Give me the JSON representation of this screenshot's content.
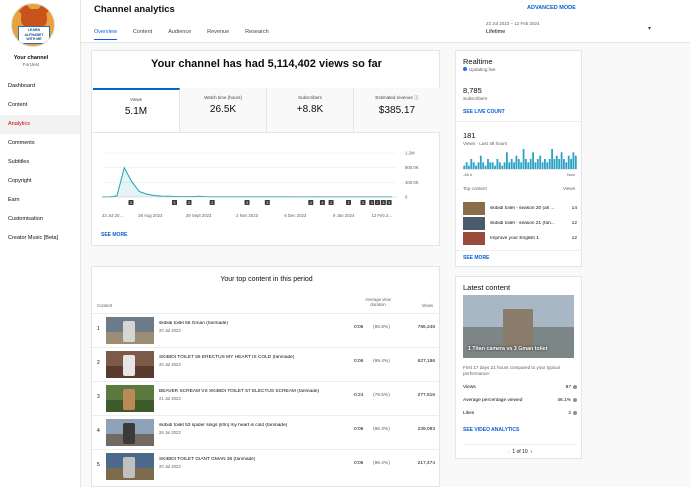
{
  "channel": {
    "name": "Your channel",
    "handle": "FortJest",
    "avatar_text": [
      "LEARN",
      "ALPHABET",
      "WITH ME"
    ]
  },
  "sidebar": {
    "items": [
      {
        "label": "Dashboard"
      },
      {
        "label": "Content"
      },
      {
        "label": "Analytics",
        "active": true
      },
      {
        "label": "Comments"
      },
      {
        "label": "Subtitles"
      },
      {
        "label": "Copyright"
      },
      {
        "label": "Earn"
      },
      {
        "label": "Customisation"
      },
      {
        "label": "Creator Music [Beta]"
      }
    ]
  },
  "header": {
    "title": "Channel analytics",
    "advanced_mode": "ADVANCED MODE",
    "tabs": [
      "Overview",
      "Content",
      "Audience",
      "Revenue",
      "Research"
    ],
    "date_range": "23 Jul 2023 – 12 Feb 2024",
    "date_value": "Lifetime"
  },
  "overview": {
    "headline": "Your channel has had 5,114,402 views so far",
    "metrics": [
      {
        "label": "Views",
        "value": "5.1M"
      },
      {
        "label": "Watch time (hours)",
        "value": "26.5K"
      },
      {
        "label": "Subscribers",
        "value": "+8.8K"
      },
      {
        "label": "Estimated revenue",
        "value": "$385.17"
      }
    ],
    "see_more": "SEE MORE"
  },
  "chart_data": {
    "type": "line",
    "series": [
      {
        "values": [
          2,
          4,
          30,
          800,
          420,
          150,
          80,
          40,
          25,
          20,
          15,
          12,
          10,
          18,
          12,
          9,
          8,
          7,
          8,
          6,
          6,
          5,
          9,
          6,
          5,
          5,
          4,
          4,
          4,
          5,
          4,
          3,
          3,
          4,
          3,
          3,
          3,
          3,
          2,
          3
        ]
      }
    ],
    "x_tick_labels": [
      "23 Jul 20...",
      "26 Aug 2023",
      "29 Sept 2023",
      "2 Nov 2023",
      "6 Dec 2023",
      "9 Jan 2024",
      "12 Feb 2..."
    ],
    "y_tick_labels": [
      "0",
      "400.0K",
      "800.0K",
      "1.2M"
    ],
    "ylim": [
      0,
      1200000
    ],
    "marker_labels": [
      "3",
      "2",
      "3",
      "2",
      "3",
      "3",
      "4",
      "4",
      "2",
      "2",
      "3",
      "3",
      "2",
      "3",
      "3"
    ]
  },
  "top_content": {
    "title": "Your top content in this period",
    "col_content": "Content",
    "col_avd": "Average view duration",
    "col_views": "Views",
    "rows": [
      {
        "n": "1",
        "title": "skibidi toilet 56 Gman (fanmade)",
        "date": "20 Jul 2023",
        "avd": "0:06",
        "pct": "(96.8%)",
        "views": "786,248"
      },
      {
        "n": "2",
        "title": "SKIBIDI TOILET 55 ERECTUS MY HEART IS COLD (fanmade)",
        "date": "20 Jul 2023",
        "avd": "0:06",
        "pct": "(99.4%)",
        "views": "627,186"
      },
      {
        "n": "3",
        "title": "BEAVER SCREAM VS SKIBIDI TOILET 57 ELECTUS SCREAM (fanmade)",
        "date": "21 Jul 2023",
        "avd": "0:24",
        "pct": "(79.5%)",
        "views": "277,516"
      },
      {
        "n": "4",
        "title": "skibidi toilet 53 spider sings [sfm] my heart is cold (fanmade)",
        "date": "28 Jul 2023",
        "avd": "0:06",
        "pct": "(96.3%)",
        "views": "239,093"
      },
      {
        "n": "5",
        "title": "SKIBIDI TOILET GIANT GMAN 36 (fanmade)",
        "date": "20 Jul 2023",
        "avd": "0:06",
        "pct": "(96.4%)",
        "views": "217,474"
      }
    ]
  },
  "realtime": {
    "title": "Realtime",
    "updating": "Updating live",
    "subs_value": "8,785",
    "subs_label": "Subscribers",
    "live_count": "SEE LIVE COUNT",
    "views_value": "181",
    "views_label": "Views · Last 48 hours",
    "axis_left": "-48 h",
    "axis_right": "Now",
    "top_content_label": "Top content",
    "views_col": "Views",
    "items": [
      {
        "title": "skibidi toilet - season 20 (all ...",
        "views": "14"
      },
      {
        "title": "skibidi toilet - season 21 (fan...",
        "views": "12"
      },
      {
        "title": "Improve your English 1",
        "views": "12"
      }
    ],
    "see_more": "SEE MORE",
    "bars": [
      1,
      2,
      1,
      3,
      2,
      1,
      2,
      4,
      2,
      1,
      3,
      2,
      2,
      1,
      3,
      2,
      1,
      2,
      5,
      2,
      3,
      2,
      4,
      3,
      2,
      6,
      3,
      2,
      3,
      5,
      2,
      3,
      4,
      2,
      3,
      2,
      3,
      6,
      3,
      4,
      3,
      5,
      3,
      2,
      4,
      3,
      5,
      4
    ]
  },
  "latest": {
    "title": "Latest content",
    "caption": "1 Titan camera vs 3 Gman toilet",
    "note": "First 17 days 21 hours compared to your typical performance:",
    "rows": [
      {
        "label": "Views",
        "value": "87"
      },
      {
        "label": "Average percentage viewed",
        "value": "46.1%"
      },
      {
        "label": "Likes",
        "value": "2"
      }
    ],
    "video_link": "SEE VIDEO ANALYTICS",
    "pager": "1 of 10"
  },
  "colors": {
    "accent": "#065fd4",
    "active_nav": "#cc0000",
    "chart_line": "#1ba0b8"
  }
}
